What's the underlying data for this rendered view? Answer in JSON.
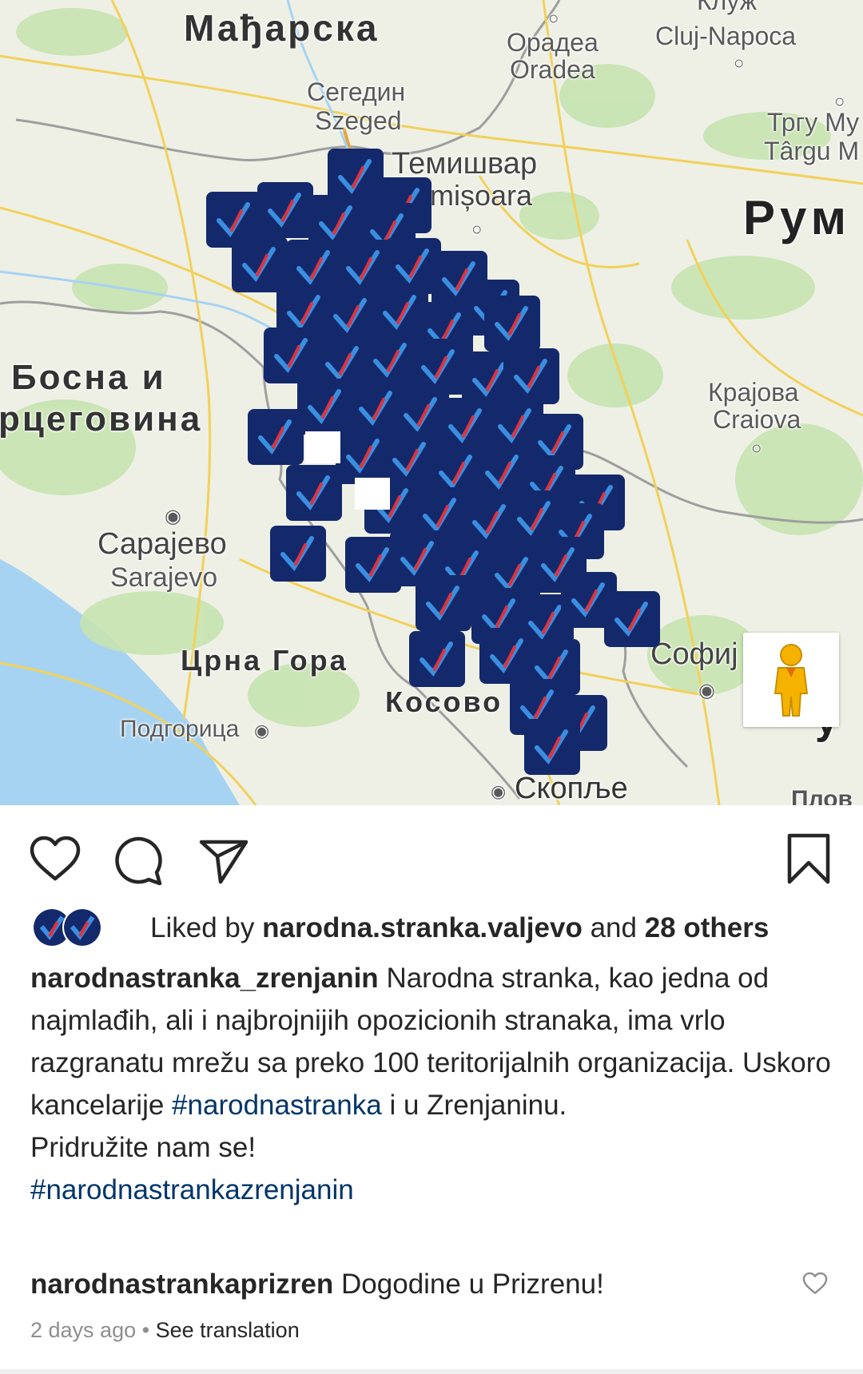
{
  "map": {
    "countries": {
      "hungary": "Мађарска",
      "romania": "Рум",
      "bosnia_line1": "Босна и",
      "bosnia_line2": "рцеговина",
      "montenegro": "Црна Гора",
      "kosovo": "Косово"
    },
    "cities": {
      "oradea_cyr": "Орадеа",
      "oradea_lat": "Oradea",
      "cluj_cyr": "Клуж",
      "cluj_lat": "Cluj-Napoca",
      "szeged_cyr": "Сегедин",
      "szeged_lat": "Szeged",
      "targu_cyr": "Тргу Му",
      "targu_lat": "Târgu M",
      "timisoara_cyr": "Темишвар",
      "timisoara_lat": "imișoara",
      "craiova_cyr": "Крајова",
      "craiova_lat": "Craiova",
      "sarajevo_cyr": "Сарајево",
      "sarajevo_lat": "Sarajevo",
      "sofia": "Софиј",
      "podgorica": "Подгорица",
      "skopje": "Скопље",
      "plovdiv": "Плов",
      "partial_u": "у"
    },
    "colors": {
      "logo_tile": "#14296b",
      "check_blue": "#3a8ee0",
      "check_red": "#e0323c",
      "sea": "#a7d3f2",
      "land": "#eef0e6",
      "forest": "#c6e3b0",
      "road": "#f2d15a",
      "border": "#9e9e9e"
    },
    "pegman_icon": "pegman-icon"
  },
  "actions": {
    "like_icon": "heart-icon",
    "comment_icon": "comment-icon",
    "share_icon": "send-icon",
    "save_icon": "bookmark-icon"
  },
  "likes": {
    "prefix": "Liked by",
    "user": "narodna.stranka.valjevo",
    "conj": "and",
    "others": "28 others"
  },
  "caption": {
    "username": "narodnastranka_zrenjanin",
    "text1": "Narodna stranka, kao jedna od najmlađih, ali i najbrojnijih opozicionih stranaka, ima vrlo razgranatu mrežu sa preko 100 teritorijalnih organizacija. Uskoro kancelarije",
    "hashtag1": "#narodnastranka",
    "text2": "i u Zrenjaninu.",
    "line2": "Pridružite nam se!",
    "hashtag2": "#narodnastrankazrenjanin"
  },
  "comment": {
    "username": "narodnastrankaprizren",
    "text": "Dogodine u Prizrenu!",
    "like_icon": "small-heart-icon"
  },
  "meta": {
    "time": "2 days ago",
    "separator": "•",
    "translate": "See translation"
  }
}
